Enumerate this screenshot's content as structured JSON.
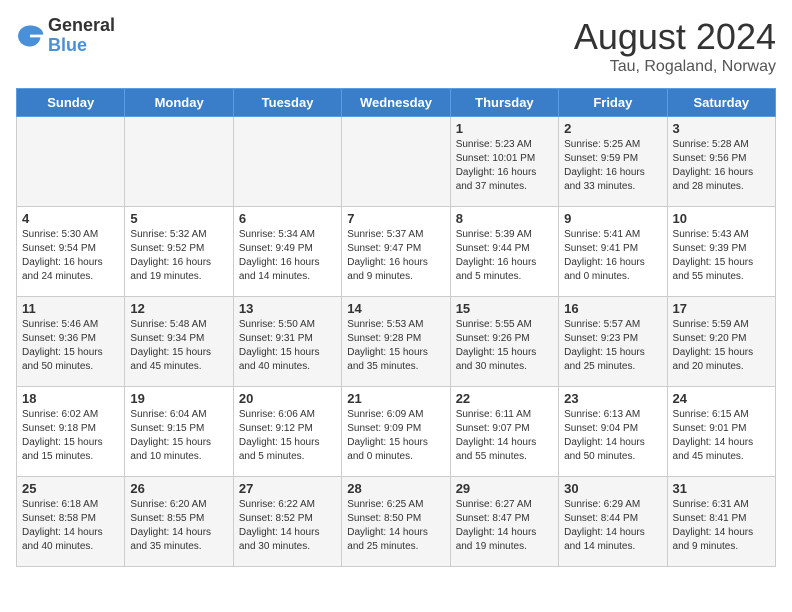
{
  "header": {
    "logo_general": "General",
    "logo_blue": "Blue",
    "month_year": "August 2024",
    "location": "Tau, Rogaland, Norway"
  },
  "days_of_week": [
    "Sunday",
    "Monday",
    "Tuesday",
    "Wednesday",
    "Thursday",
    "Friday",
    "Saturday"
  ],
  "weeks": [
    [
      {
        "day": "",
        "info": ""
      },
      {
        "day": "",
        "info": ""
      },
      {
        "day": "",
        "info": ""
      },
      {
        "day": "",
        "info": ""
      },
      {
        "day": "1",
        "info": "Sunrise: 5:23 AM\nSunset: 10:01 PM\nDaylight: 16 hours\nand 37 minutes."
      },
      {
        "day": "2",
        "info": "Sunrise: 5:25 AM\nSunset: 9:59 PM\nDaylight: 16 hours\nand 33 minutes."
      },
      {
        "day": "3",
        "info": "Sunrise: 5:28 AM\nSunset: 9:56 PM\nDaylight: 16 hours\nand 28 minutes."
      }
    ],
    [
      {
        "day": "4",
        "info": "Sunrise: 5:30 AM\nSunset: 9:54 PM\nDaylight: 16 hours\nand 24 minutes."
      },
      {
        "day": "5",
        "info": "Sunrise: 5:32 AM\nSunset: 9:52 PM\nDaylight: 16 hours\nand 19 minutes."
      },
      {
        "day": "6",
        "info": "Sunrise: 5:34 AM\nSunset: 9:49 PM\nDaylight: 16 hours\nand 14 minutes."
      },
      {
        "day": "7",
        "info": "Sunrise: 5:37 AM\nSunset: 9:47 PM\nDaylight: 16 hours\nand 9 minutes."
      },
      {
        "day": "8",
        "info": "Sunrise: 5:39 AM\nSunset: 9:44 PM\nDaylight: 16 hours\nand 5 minutes."
      },
      {
        "day": "9",
        "info": "Sunrise: 5:41 AM\nSunset: 9:41 PM\nDaylight: 16 hours\nand 0 minutes."
      },
      {
        "day": "10",
        "info": "Sunrise: 5:43 AM\nSunset: 9:39 PM\nDaylight: 15 hours\nand 55 minutes."
      }
    ],
    [
      {
        "day": "11",
        "info": "Sunrise: 5:46 AM\nSunset: 9:36 PM\nDaylight: 15 hours\nand 50 minutes."
      },
      {
        "day": "12",
        "info": "Sunrise: 5:48 AM\nSunset: 9:34 PM\nDaylight: 15 hours\nand 45 minutes."
      },
      {
        "day": "13",
        "info": "Sunrise: 5:50 AM\nSunset: 9:31 PM\nDaylight: 15 hours\nand 40 minutes."
      },
      {
        "day": "14",
        "info": "Sunrise: 5:53 AM\nSunset: 9:28 PM\nDaylight: 15 hours\nand 35 minutes."
      },
      {
        "day": "15",
        "info": "Sunrise: 5:55 AM\nSunset: 9:26 PM\nDaylight: 15 hours\nand 30 minutes."
      },
      {
        "day": "16",
        "info": "Sunrise: 5:57 AM\nSunset: 9:23 PM\nDaylight: 15 hours\nand 25 minutes."
      },
      {
        "day": "17",
        "info": "Sunrise: 5:59 AM\nSunset: 9:20 PM\nDaylight: 15 hours\nand 20 minutes."
      }
    ],
    [
      {
        "day": "18",
        "info": "Sunrise: 6:02 AM\nSunset: 9:18 PM\nDaylight: 15 hours\nand 15 minutes."
      },
      {
        "day": "19",
        "info": "Sunrise: 6:04 AM\nSunset: 9:15 PM\nDaylight: 15 hours\nand 10 minutes."
      },
      {
        "day": "20",
        "info": "Sunrise: 6:06 AM\nSunset: 9:12 PM\nDaylight: 15 hours\nand 5 minutes."
      },
      {
        "day": "21",
        "info": "Sunrise: 6:09 AM\nSunset: 9:09 PM\nDaylight: 15 hours\nand 0 minutes."
      },
      {
        "day": "22",
        "info": "Sunrise: 6:11 AM\nSunset: 9:07 PM\nDaylight: 14 hours\nand 55 minutes."
      },
      {
        "day": "23",
        "info": "Sunrise: 6:13 AM\nSunset: 9:04 PM\nDaylight: 14 hours\nand 50 minutes."
      },
      {
        "day": "24",
        "info": "Sunrise: 6:15 AM\nSunset: 9:01 PM\nDaylight: 14 hours\nand 45 minutes."
      }
    ],
    [
      {
        "day": "25",
        "info": "Sunrise: 6:18 AM\nSunset: 8:58 PM\nDaylight: 14 hours\nand 40 minutes."
      },
      {
        "day": "26",
        "info": "Sunrise: 6:20 AM\nSunset: 8:55 PM\nDaylight: 14 hours\nand 35 minutes."
      },
      {
        "day": "27",
        "info": "Sunrise: 6:22 AM\nSunset: 8:52 PM\nDaylight: 14 hours\nand 30 minutes."
      },
      {
        "day": "28",
        "info": "Sunrise: 6:25 AM\nSunset: 8:50 PM\nDaylight: 14 hours\nand 25 minutes."
      },
      {
        "day": "29",
        "info": "Sunrise: 6:27 AM\nSunset: 8:47 PM\nDaylight: 14 hours\nand 19 minutes."
      },
      {
        "day": "30",
        "info": "Sunrise: 6:29 AM\nSunset: 8:44 PM\nDaylight: 14 hours\nand 14 minutes."
      },
      {
        "day": "31",
        "info": "Sunrise: 6:31 AM\nSunset: 8:41 PM\nDaylight: 14 hours\nand 9 minutes."
      }
    ]
  ]
}
